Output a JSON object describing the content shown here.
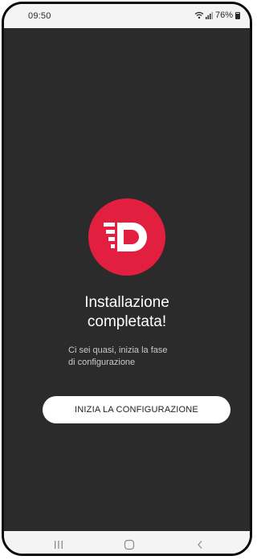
{
  "status_bar": {
    "time": "09:50",
    "battery": "76%",
    "icons": [
      "wifi-icon",
      "signal-icon",
      "battery-icon"
    ]
  },
  "logo": {
    "icon": "brand-d-logo-icon",
    "color": "#e31f3f"
  },
  "content": {
    "title_line1": "Installazione",
    "title_line2": "completata!",
    "subtitle_line1": "Ci sei quasi, inizia la fase",
    "subtitle_line2": "di configurazione",
    "button_label": "INIZIA LA CONFIGURAZIONE"
  },
  "nav_bar": {
    "icons": [
      "recent-apps-icon",
      "home-icon",
      "back-icon"
    ]
  },
  "colors": {
    "background": "#2b2b2b",
    "accent": "#e31f3f",
    "button": "#ffffff"
  }
}
